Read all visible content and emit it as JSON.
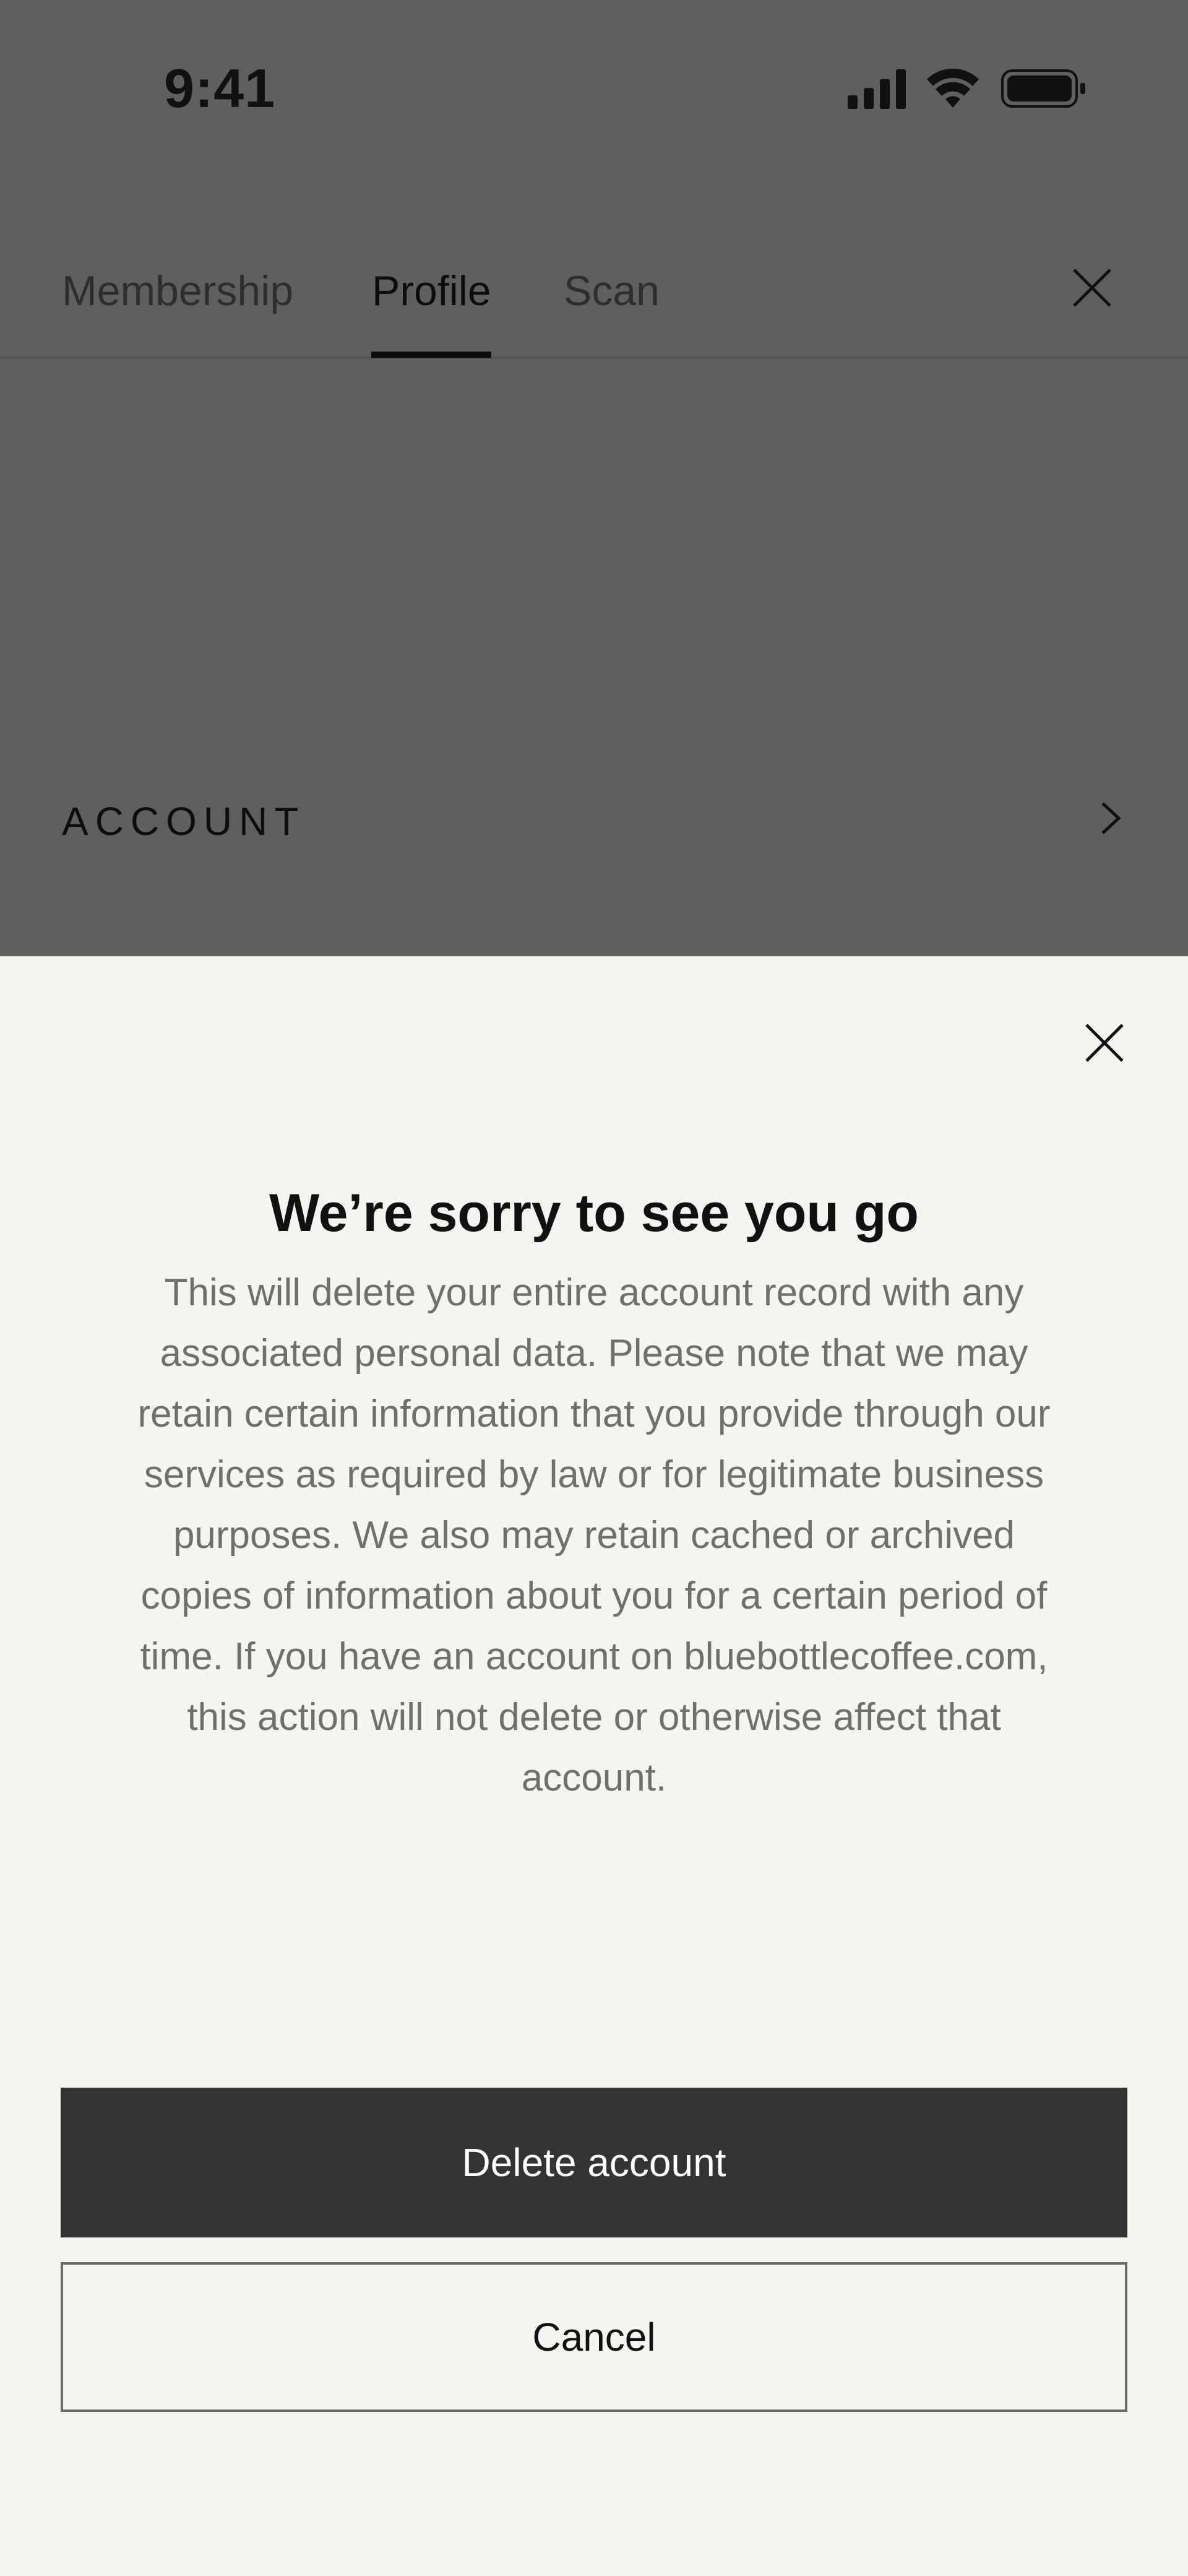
{
  "status_bar": {
    "time": "9:41"
  },
  "tabs": {
    "items": [
      {
        "label": "Membership"
      },
      {
        "label": "Profile",
        "active": true
      },
      {
        "label": "Scan"
      }
    ]
  },
  "account": {
    "label": "ACCOUNT"
  },
  "sheet": {
    "title": "We’re sorry to see you go",
    "body": "This will delete your entire account record with any associated personal data. Please note that we may retain certain information that you provide through our services as required by law or for legitimate business purposes. We also may retain cached or archived copies of information about you for a certain period of time. If you have an account on bluebottlecoffee.com, this action will not delete or otherwise affect that account.",
    "primary_button": "Delete account",
    "secondary_button": "Cancel"
  },
  "icons": {
    "signal": "signal-icon",
    "wifi": "wifi-icon",
    "battery": "battery-icon",
    "tabs_close": "close-icon",
    "account_chevron": "chevron-right-icon",
    "sheet_close": "close-icon"
  },
  "colors": {
    "overlay_bg": "#5f5f5d",
    "sheet_bg": "#f4f4f0",
    "primary_button_bg": "#333333"
  }
}
